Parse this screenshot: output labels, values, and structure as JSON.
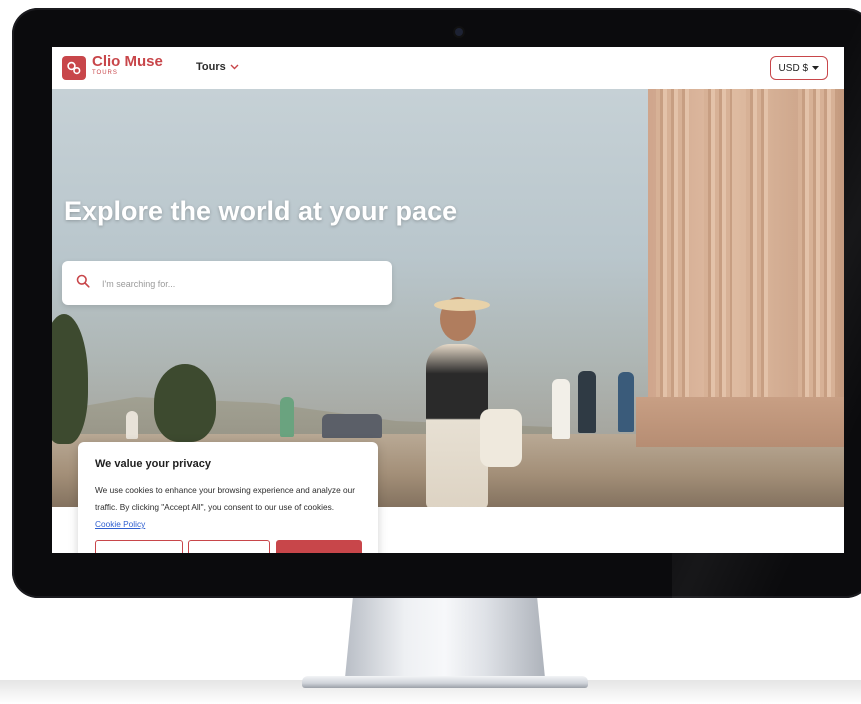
{
  "brand": {
    "name": "Clio Muse",
    "subtitle": "TOURS",
    "accent_color": "#c8464a"
  },
  "nav": {
    "tours_label": "Tours",
    "currency_label": "USD $"
  },
  "hero": {
    "title": "Explore the world at your pace",
    "search_placeholder": "I'm searching for..."
  },
  "cookie_banner": {
    "title": "We value your privacy",
    "text": "We use cookies to enhance your browsing experience and analyze our traffic. By clicking \"Accept All\", you consent to our use of cookies.",
    "policy_link": "Cookie Policy",
    "buttons": [
      "",
      "",
      ""
    ]
  },
  "icons": {
    "logo": "clio-muse-logo-icon",
    "tours_chevron": "chevron-down-icon",
    "currency_caret": "caret-down-icon",
    "search": "search-icon"
  }
}
